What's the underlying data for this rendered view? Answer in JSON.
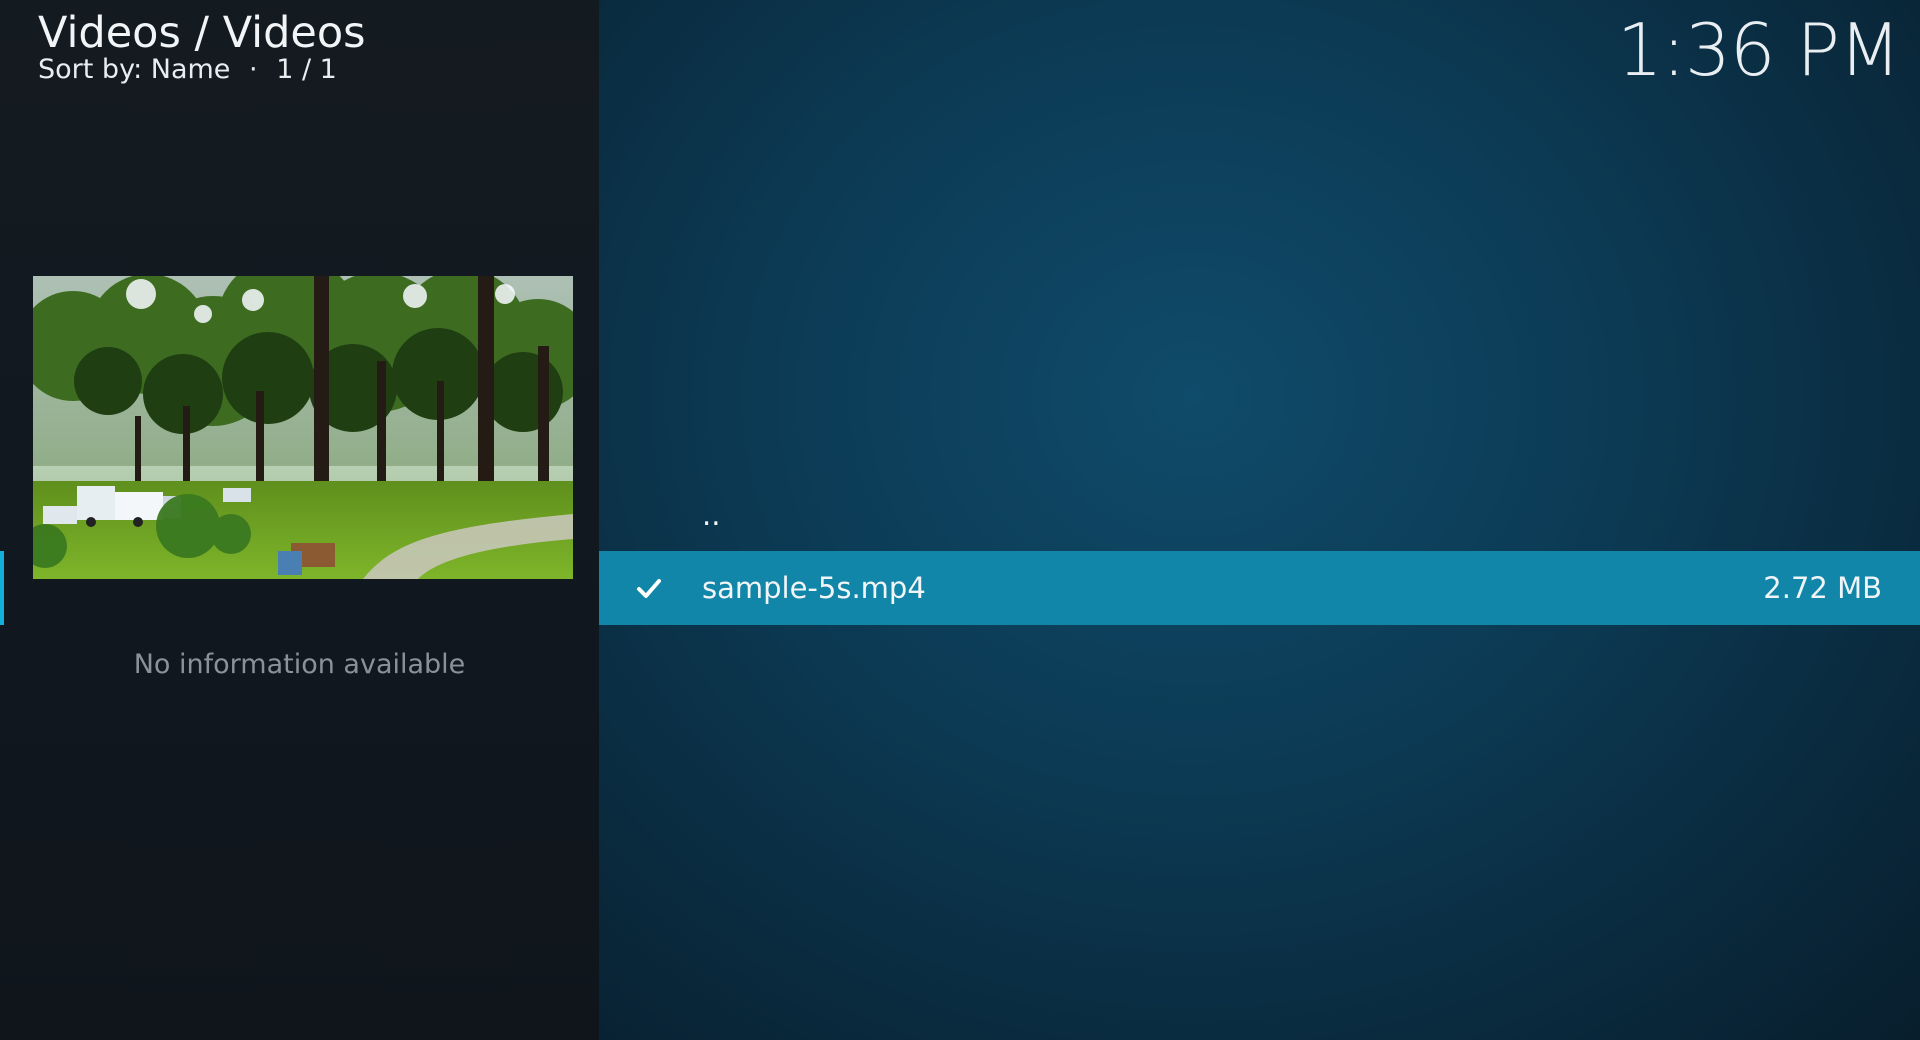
{
  "header": {
    "breadcrumb": "Videos / Videos",
    "sort_label": "Sort by: Name",
    "separator": "·",
    "page_count": "1 / 1"
  },
  "clock": {
    "time": "1:36 PM"
  },
  "info_panel": {
    "thumbnail_icon": "video-thumbnail-trees-park",
    "no_info_text": "No information available"
  },
  "file_list": {
    "items": [
      {
        "label": "..",
        "size": ""
      },
      {
        "label": "sample-5s.mp4",
        "size": "2.72 MB",
        "watched": true,
        "status_icon": "check-icon"
      }
    ]
  },
  "colors": {
    "selection": "#1186a8",
    "accent": "#12b0d9",
    "left_panel_bg": "#111820",
    "main_bg": "#0c3a54",
    "secondary_text": "#8a9299"
  }
}
